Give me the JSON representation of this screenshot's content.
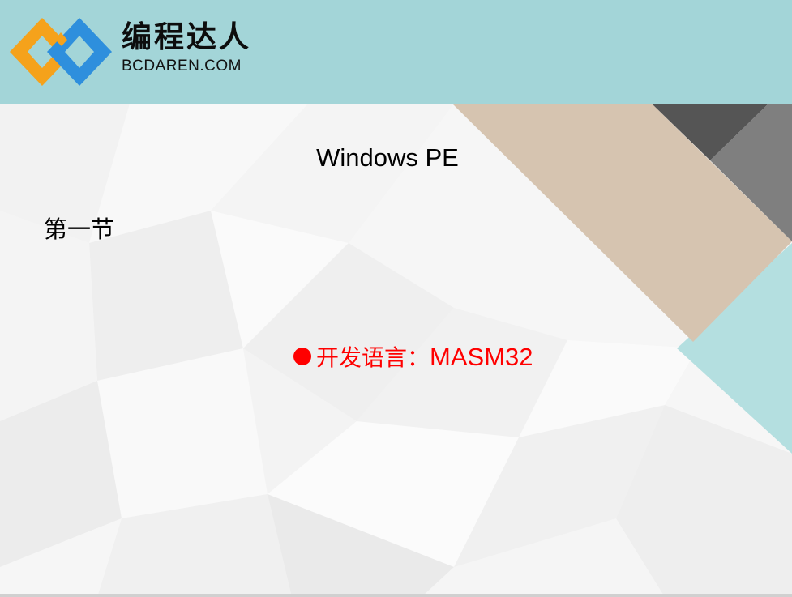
{
  "header": {
    "logo_name": "编程达人",
    "logo_domain": "BCDAREN.COM"
  },
  "slide": {
    "title": "Windows PE",
    "section": "第一节",
    "bullet": {
      "label": "开发语言：",
      "value": "MASM32"
    }
  },
  "colors": {
    "header_band": "#a3d5d8",
    "logo_orange": "#f5a21b",
    "logo_blue": "#2e8fdd",
    "accent_tan": "#d6c4b0",
    "accent_dark_gray": "#555555",
    "accent_mid_gray": "#7f7f7f",
    "accent_teal": "#b4dfe0",
    "bullet_red": "#ff0000"
  },
  "icons": {
    "logo": "interlocking-diamonds-logo",
    "bullet": "filled-circle-bullet"
  }
}
